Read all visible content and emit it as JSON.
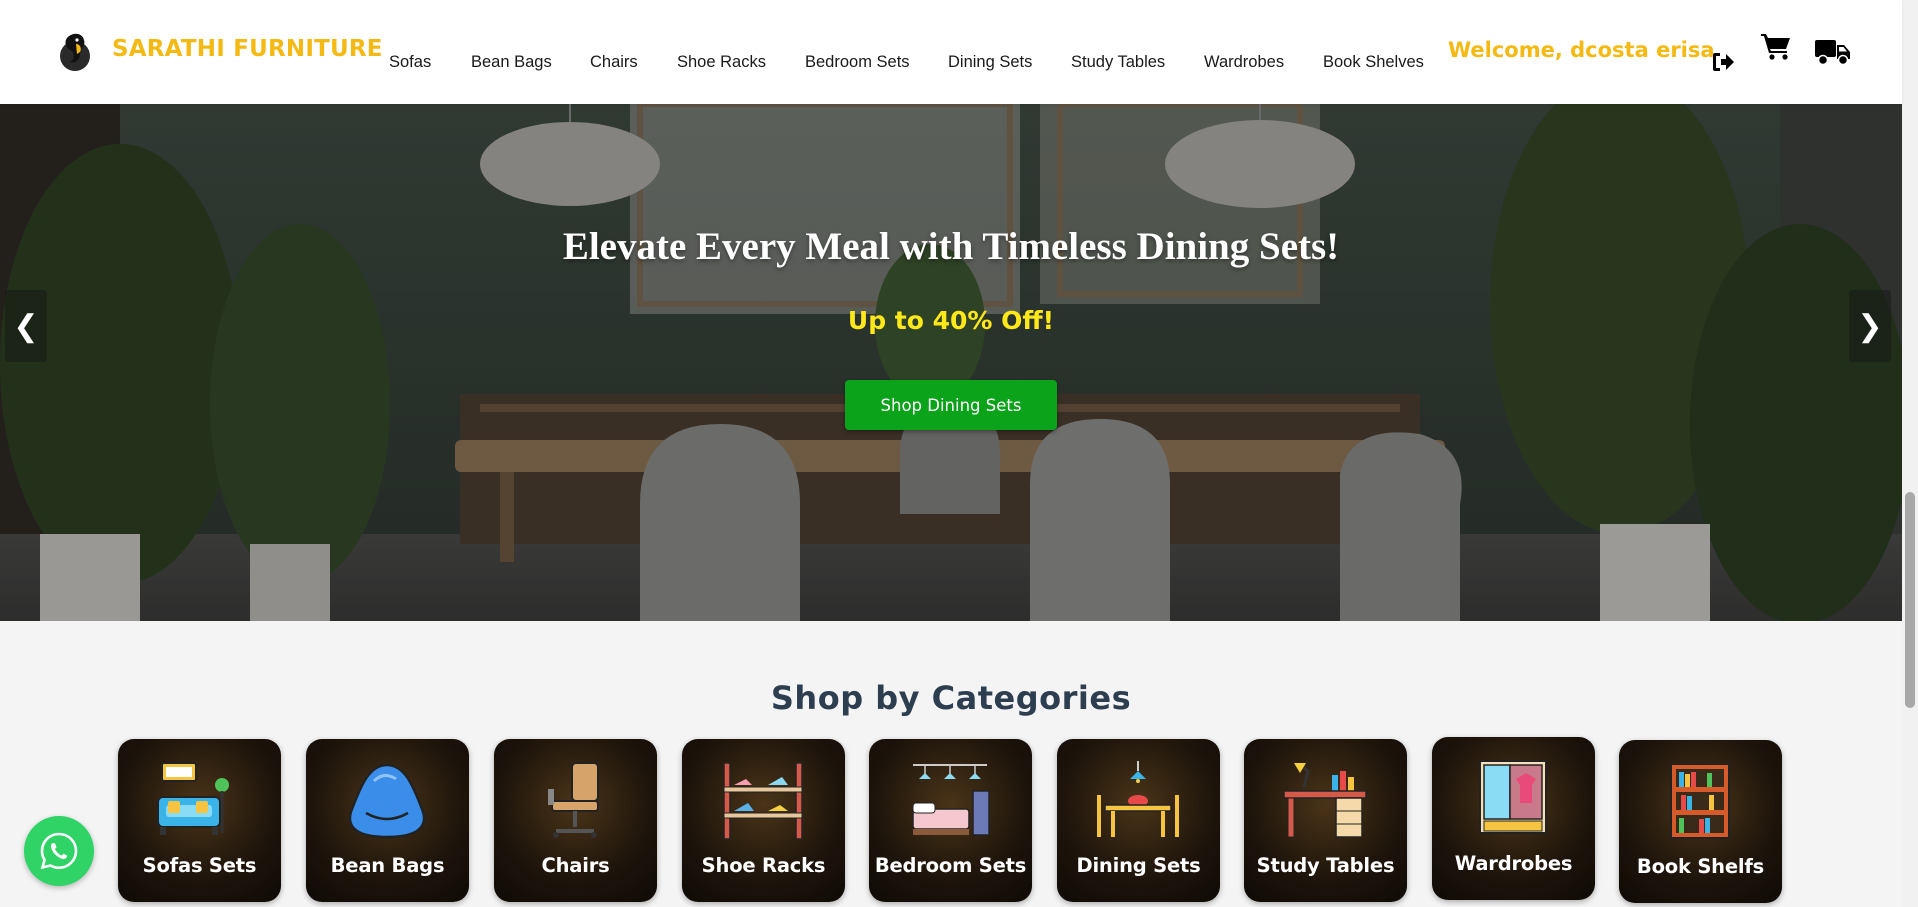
{
  "header": {
    "brand": "SARATHI FURNITURE",
    "nav": [
      "Sofas",
      "Bean Bags",
      "Chairs",
      "Shoe Racks",
      "Bedroom Sets",
      "Dining Sets",
      "Study Tables",
      "Wardrobes",
      "Book Shelves"
    ],
    "welcome": "Welcome, dcosta erisa",
    "icons": [
      "logout-icon",
      "cart-icon",
      "truck-icon"
    ]
  },
  "banner": {
    "title": "Elevate Every Meal with Timeless Dining Sets!",
    "subtitle": "Up to 40% Off!",
    "button": "Shop Dining Sets",
    "prev": "❮",
    "next": "❯"
  },
  "categories": {
    "title": "Shop by Categories",
    "items": [
      "Sofas Sets",
      "Bean Bags",
      "Chairs",
      "Shoe Racks",
      "Bedroom Sets",
      "Dining Sets",
      "Study Tables",
      "Wardrobes",
      "Book Shelfs"
    ]
  },
  "colors": {
    "brand": "#f5b914",
    "cta": "#0aa31a",
    "subtitle": "#ffe81a",
    "whatsapp": "#2fd366"
  }
}
